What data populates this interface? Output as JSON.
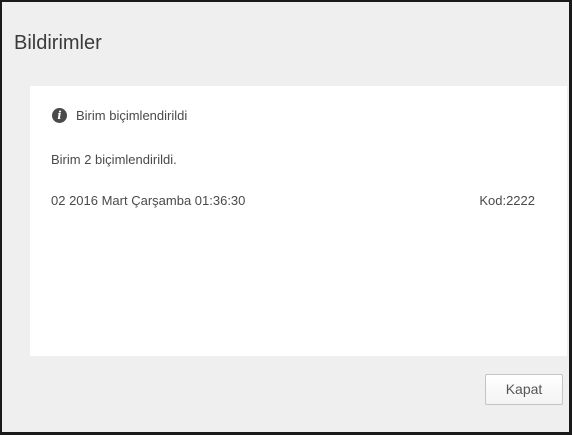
{
  "dialog": {
    "title": "Bildirimler",
    "close_label": "Kapat"
  },
  "notification": {
    "icon": "info-icon",
    "icon_glyph": "i",
    "heading": "Birim biçimlendirildi",
    "message": "Birim 2 biçimlendirildi.",
    "timestamp": "02 2016 Mart Çarşamba 01:36:30",
    "code": "Kod:2222"
  }
}
